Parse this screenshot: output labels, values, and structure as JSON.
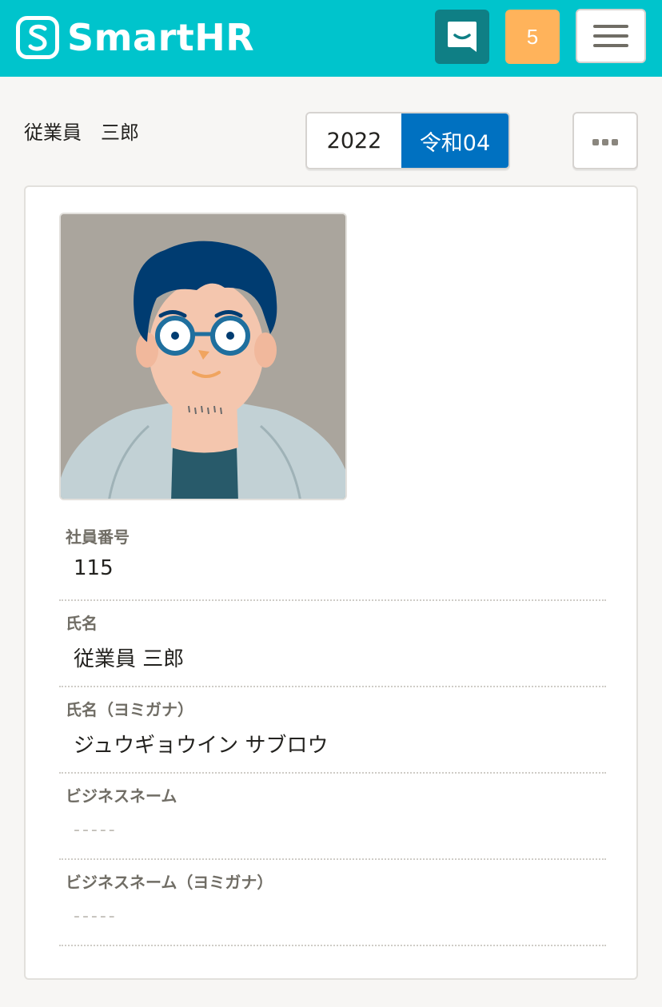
{
  "header": {
    "logo_text": "SmartHR",
    "notification_count": "5",
    "brand_color": "#00c4cc",
    "chat_button_color": "#0f7f85",
    "notification_color": "#ffb35b"
  },
  "employee": {
    "title_name": "従業員　三郎"
  },
  "year_toggle": {
    "gregorian": "2022",
    "japanese": "令和04",
    "selected": "令和04",
    "selected_color": "#0071c1"
  },
  "fields": [
    {
      "label": "社員番号",
      "value": "115"
    },
    {
      "label": "氏名",
      "value": "従業員 三郎"
    },
    {
      "label": "氏名（ヨミガナ）",
      "value": "ジュウギョウイン サブロウ"
    },
    {
      "label": "ビジネスネーム",
      "value": "-----"
    },
    {
      "label": "ビジネスネーム（ヨミガナ）",
      "value": "-----"
    }
  ],
  "icons": {
    "logo": "smarthr-logo-icon",
    "chat": "chat-icon",
    "menu": "hamburger-icon",
    "more": "more-dots-icon"
  }
}
